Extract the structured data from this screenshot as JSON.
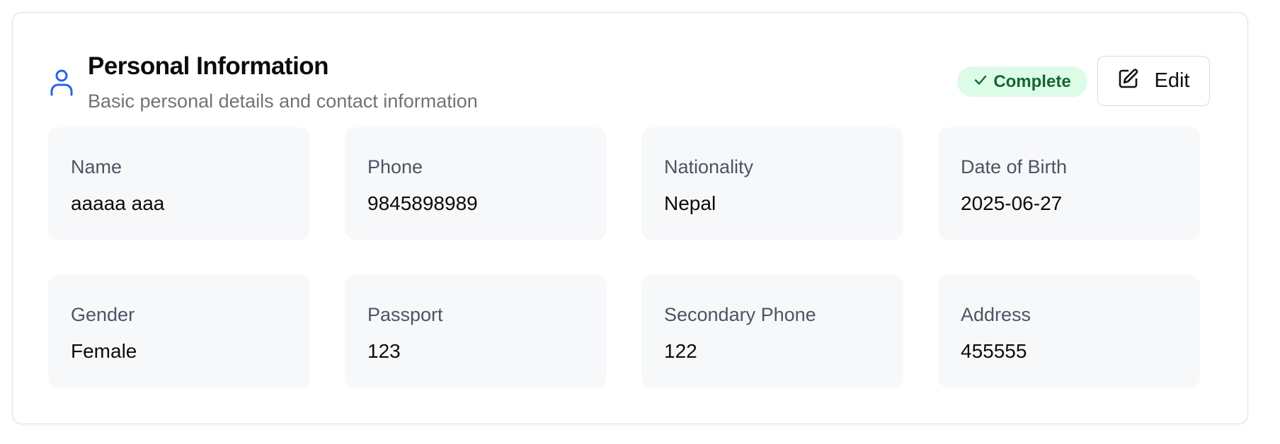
{
  "section": {
    "icon": "user-icon",
    "title": "Personal Information",
    "subtitle": "Basic personal details and contact information",
    "status_badge": {
      "icon": "check-icon",
      "label": "Complete",
      "background": "#dcfce7",
      "color": "#166534"
    },
    "edit_button": {
      "icon": "edit-icon",
      "label": "Edit"
    }
  },
  "fields": [
    {
      "label": "Name",
      "value": "aaaaa aaa"
    },
    {
      "label": "Phone",
      "value": "9845898989"
    },
    {
      "label": "Nationality",
      "value": "Nepal"
    },
    {
      "label": "Date of Birth",
      "value": "2025-06-27"
    },
    {
      "label": "Gender",
      "value": "Female"
    },
    {
      "label": "Passport",
      "value": "123"
    },
    {
      "label": "Secondary Phone",
      "value": "122"
    },
    {
      "label": "Address",
      "value": "455555"
    }
  ],
  "colors": {
    "accent": "#2563eb",
    "field_background": "#f7f8fa",
    "label": "#4b5563",
    "subtitle": "#737373"
  }
}
